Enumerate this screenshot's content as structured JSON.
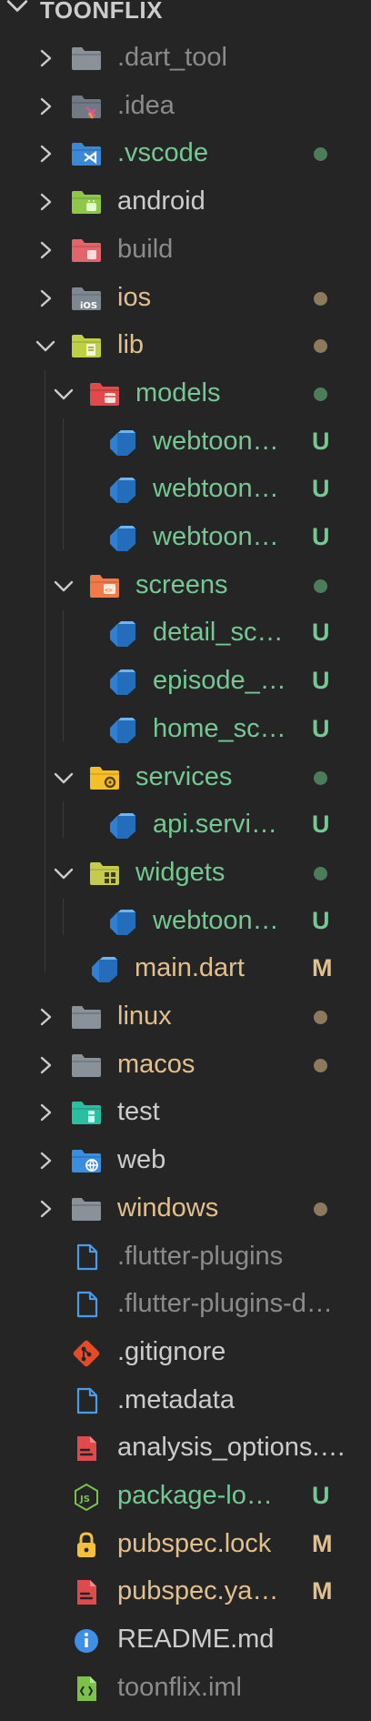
{
  "explorer": {
    "root": "TOONFLIX"
  },
  "colors": {
    "background": "#252526",
    "default_text": "#cccccc",
    "ignored_text": "#8b8b8b",
    "untracked_text": "#73c991",
    "modified_text": "#e2c08d",
    "untracked_dot": "#4b7d5b",
    "modified_dot": "#8c7a5c"
  },
  "rows": [
    {
      "name": ".dart_tool",
      "icon": "folder-gray-icon",
      "expanded": false,
      "state": "ignored",
      "status": ""
    },
    {
      "name": ".idea",
      "icon": "folder-idea-icon",
      "expanded": false,
      "state": "ignored",
      "status": ""
    },
    {
      "name": ".vscode",
      "icon": "folder-vscode-icon",
      "expanded": false,
      "state": "untracked",
      "status": "dot"
    },
    {
      "name": "android",
      "icon": "folder-android-icon",
      "expanded": false,
      "state": "default",
      "status": ""
    },
    {
      "name": "build",
      "icon": "folder-build-icon",
      "expanded": false,
      "state": "ignored",
      "status": ""
    },
    {
      "name": "ios",
      "icon": "folder-ios-icon",
      "expanded": false,
      "state": "modified",
      "status": "dot"
    },
    {
      "name": "lib",
      "icon": "folder-lib-icon",
      "expanded": true,
      "state": "modified",
      "status": "dot"
    },
    {
      "name": "models",
      "icon": "folder-models-icon",
      "expanded": true,
      "state": "untracked",
      "status": "dot"
    },
    {
      "name": "webtoon…",
      "icon": "dart-file-icon",
      "state": "untracked",
      "status": "U"
    },
    {
      "name": "webtoon…",
      "icon": "dart-file-icon",
      "state": "untracked",
      "status": "U"
    },
    {
      "name": "webtoon…",
      "icon": "dart-file-icon",
      "state": "untracked",
      "status": "U"
    },
    {
      "name": "screens",
      "icon": "folder-screens-icon",
      "expanded": true,
      "state": "untracked",
      "status": "dot"
    },
    {
      "name": "detail_sc…",
      "icon": "dart-file-icon",
      "state": "untracked",
      "status": "U"
    },
    {
      "name": "episode_…",
      "icon": "dart-file-icon",
      "state": "untracked",
      "status": "U"
    },
    {
      "name": "home_sc…",
      "icon": "dart-file-icon",
      "state": "untracked",
      "status": "U"
    },
    {
      "name": "services",
      "icon": "folder-services-icon",
      "expanded": true,
      "state": "untracked",
      "status": "dot"
    },
    {
      "name": "api.servi…",
      "icon": "dart-file-icon",
      "state": "untracked",
      "status": "U"
    },
    {
      "name": "widgets",
      "icon": "folder-widgets-icon",
      "expanded": true,
      "state": "untracked",
      "status": "dot"
    },
    {
      "name": "webtoon…",
      "icon": "dart-file-icon",
      "state": "untracked",
      "status": "U"
    },
    {
      "name": "main.dart",
      "icon": "dart-file-icon",
      "state": "modified",
      "status": "M"
    },
    {
      "name": "linux",
      "icon": "folder-gray-icon",
      "expanded": false,
      "state": "modified",
      "status": "dot"
    },
    {
      "name": "macos",
      "icon": "folder-gray-icon",
      "expanded": false,
      "state": "modified",
      "status": "dot"
    },
    {
      "name": "test",
      "icon": "folder-test-icon",
      "expanded": false,
      "state": "default",
      "status": ""
    },
    {
      "name": "web",
      "icon": "folder-web-icon",
      "expanded": false,
      "state": "default",
      "status": ""
    },
    {
      "name": "windows",
      "icon": "folder-gray-icon",
      "expanded": false,
      "state": "modified",
      "status": "dot"
    },
    {
      "name": ".flutter-plugins",
      "icon": "file-blue-icon",
      "state": "ignored",
      "status": ""
    },
    {
      "name": ".flutter-plugins-d…",
      "icon": "file-blue-icon",
      "state": "ignored",
      "status": ""
    },
    {
      "name": ".gitignore",
      "icon": "git-icon",
      "state": "default",
      "status": ""
    },
    {
      "name": ".metadata",
      "icon": "file-blue-icon",
      "state": "default",
      "status": ""
    },
    {
      "name": "analysis_options.…",
      "icon": "yaml-file-icon",
      "state": "default",
      "status": ""
    },
    {
      "name": "package-lo…",
      "icon": "json-file-icon",
      "state": "untracked",
      "status": "U"
    },
    {
      "name": "pubspec.lock",
      "icon": "lock-icon",
      "state": "modified",
      "status": "M"
    },
    {
      "name": "pubspec.ya…",
      "icon": "yaml-file-icon",
      "state": "modified",
      "status": "M"
    },
    {
      "name": "README.md",
      "icon": "info-icon",
      "state": "default",
      "status": ""
    },
    {
      "name": "toonflix.iml",
      "icon": "iml-file-icon",
      "state": "ignored",
      "status": ""
    }
  ]
}
